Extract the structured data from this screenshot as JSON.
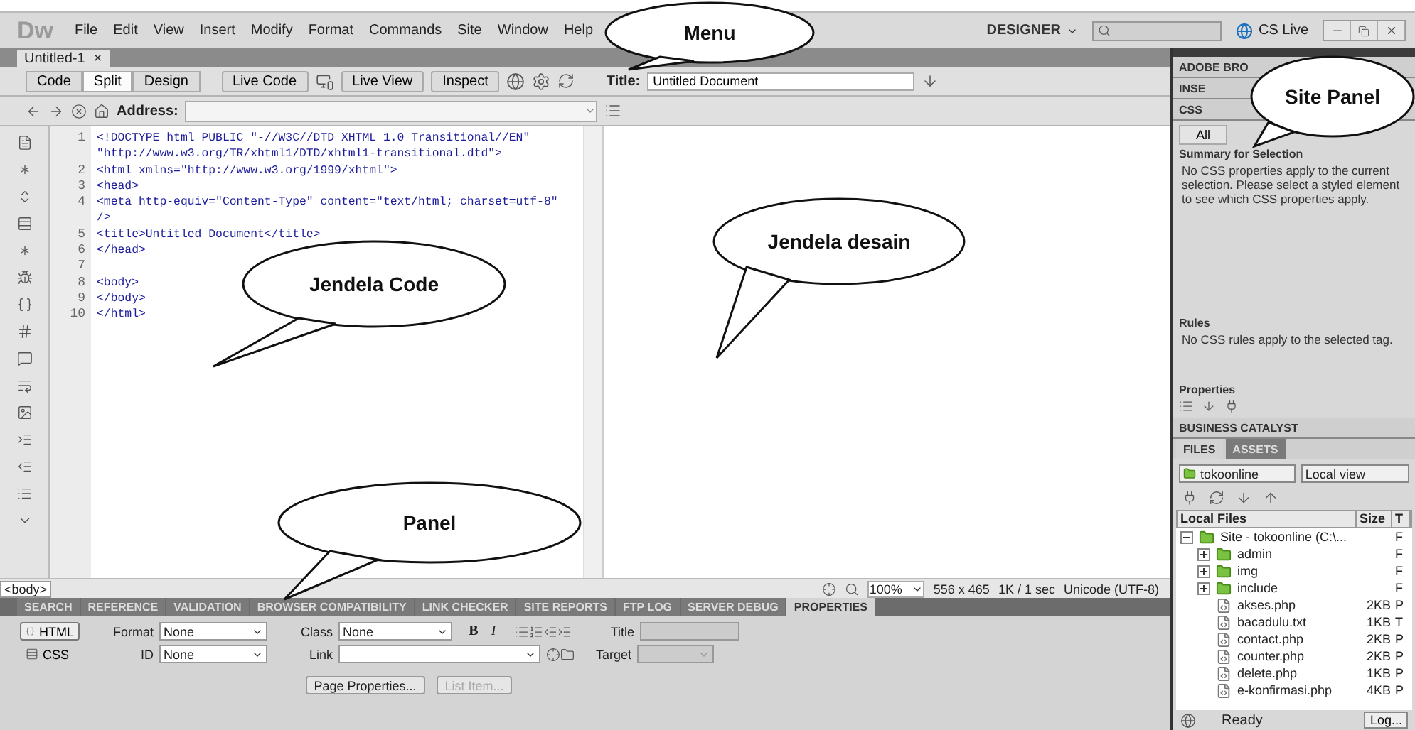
{
  "app": {
    "logo": "Dw",
    "menu": [
      "File",
      "Edit",
      "View",
      "Insert",
      "Modify",
      "Format",
      "Commands",
      "Site",
      "Window",
      "Help"
    ],
    "workspace": "DESIGNER",
    "cs_live": "CS Live"
  },
  "document_tab": {
    "label": "Untitled-1",
    "close": "×"
  },
  "toolbar": {
    "views": [
      {
        "label": "Code",
        "selected": false
      },
      {
        "label": "Split",
        "selected": true
      },
      {
        "label": "Design",
        "selected": false
      }
    ],
    "live_code": "Live Code",
    "live_view": "Live View",
    "inspect": "Inspect",
    "title_label": "Title:",
    "title_value": "Untitled Document",
    "address_label": "Address:"
  },
  "code_lines": [
    {
      "number": "1",
      "text": "<!DOCTYPE html PUBLIC \"-//W3C//DTD XHTML 1.0 Transitional//EN\""
    },
    {
      "text": "\"http://www.w3.org/TR/xhtml1/DTD/xhtml1-transitional.dtd\">"
    },
    {
      "number": "2",
      "text": "<html xmlns=\"http://www.w3.org/1999/xhtml\">"
    },
    {
      "number": "3",
      "text": "<head>"
    },
    {
      "number": "4",
      "text": "<meta http-equiv=\"Content-Type\" content=\"text/html; charset=utf-8\""
    },
    {
      "text": "/>"
    },
    {
      "number": "5",
      "text": "<title>Untitled Document</title>"
    },
    {
      "number": "6",
      "text": "</head>"
    },
    {
      "number": "7"
    },
    {
      "number": "8",
      "text": "<body>"
    },
    {
      "number": "9",
      "text": "</body>"
    },
    {
      "number": "10",
      "text": "</html>"
    }
  ],
  "status_bar": {
    "tag": "<body>",
    "zoom": "100%",
    "window_size": "556 x 465",
    "download": "1K / 1 sec",
    "encoding": "Unicode (UTF-8)"
  },
  "panel_tabs": [
    {
      "label": "SEARCH",
      "selected": false
    },
    {
      "label": "REFERENCE",
      "selected": false
    },
    {
      "label": "VALIDATION",
      "selected": false
    },
    {
      "label": "BROWSER COMPATIBILITY",
      "selected": false
    },
    {
      "label": "LINK CHECKER",
      "selected": false
    },
    {
      "label": "SITE REPORTS",
      "selected": false
    },
    {
      "label": "FTP LOG",
      "selected": false
    },
    {
      "label": "SERVER DEBUG",
      "selected": false
    },
    {
      "label": "PROPERTIES",
      "selected": true
    }
  ],
  "properties": {
    "modes": [
      {
        "label": "HTML",
        "selected": true
      },
      {
        "label": "CSS",
        "selected": false
      }
    ],
    "format_label": "Format",
    "format_value": "None",
    "id_label": "ID",
    "id_value": "None",
    "class_label": "Class",
    "class_value": "None",
    "text_styles": [
      "B",
      "I"
    ],
    "link_label": "Link",
    "title_label": "Title",
    "target_label": "Target",
    "buttons": [
      {
        "label": "Page Properties...",
        "disabled": false
      },
      {
        "label": "List Item...",
        "disabled": true
      }
    ]
  },
  "side_panels": [
    "ADOBE BRO",
    "INSE",
    "CSS"
  ],
  "css_tabs": [
    {
      "label": "All",
      "selected": false
    }
  ],
  "css_styles": {
    "summary_heading": "Summary for Selection",
    "summary_text": "No CSS properties apply to the current selection.  Please select a styled element to see which CSS properties apply.",
    "rules_heading": "Rules",
    "rules_text": "No CSS rules apply to the selected tag.",
    "properties_heading": "Properties"
  },
  "business_catalyst": "BUSINESS CATALYST",
  "files_tabs": [
    {
      "label": "FILES",
      "selected": true
    },
    {
      "label": "ASSETS",
      "selected": false
    }
  ],
  "files": {
    "site": "tokoonline",
    "view": "Local view",
    "columns": [
      "Local Files",
      "Size",
      "T"
    ],
    "tree": [
      {
        "kind": "site",
        "name": "Site - tokoonline (C:\\...",
        "type": "F",
        "expanded": true,
        "children": [
          {
            "kind": "folder",
            "name": "admin",
            "type": "F",
            "expanded": false
          },
          {
            "kind": "folder",
            "name": "img",
            "type": "F",
            "expanded": false
          },
          {
            "kind": "folder",
            "name": "include",
            "type": "F",
            "expanded": false
          },
          {
            "kind": "file",
            "name": "akses.php",
            "size": "2KB",
            "type": "P"
          },
          {
            "kind": "file",
            "name": "bacadulu.txt",
            "size": "1KB",
            "type": "T"
          },
          {
            "kind": "file",
            "name": "contact.php",
            "size": "2KB",
            "type": "P"
          },
          {
            "kind": "file",
            "name": "counter.php",
            "size": "2KB",
            "type": "P"
          },
          {
            "kind": "file",
            "name": "delete.php",
            "size": "1KB",
            "type": "P"
          },
          {
            "kind": "file",
            "name": "e-konfirmasi.php",
            "size": "4KB",
            "type": "P"
          }
        ]
      }
    ],
    "status": "Ready",
    "log_button": "Log..."
  },
  "callouts": [
    {
      "text": "Menu"
    },
    {
      "text": "Site Panel"
    },
    {
      "text": "Jendela Code"
    },
    {
      "text": "Jendela desain"
    },
    {
      "text": "Panel"
    }
  ]
}
